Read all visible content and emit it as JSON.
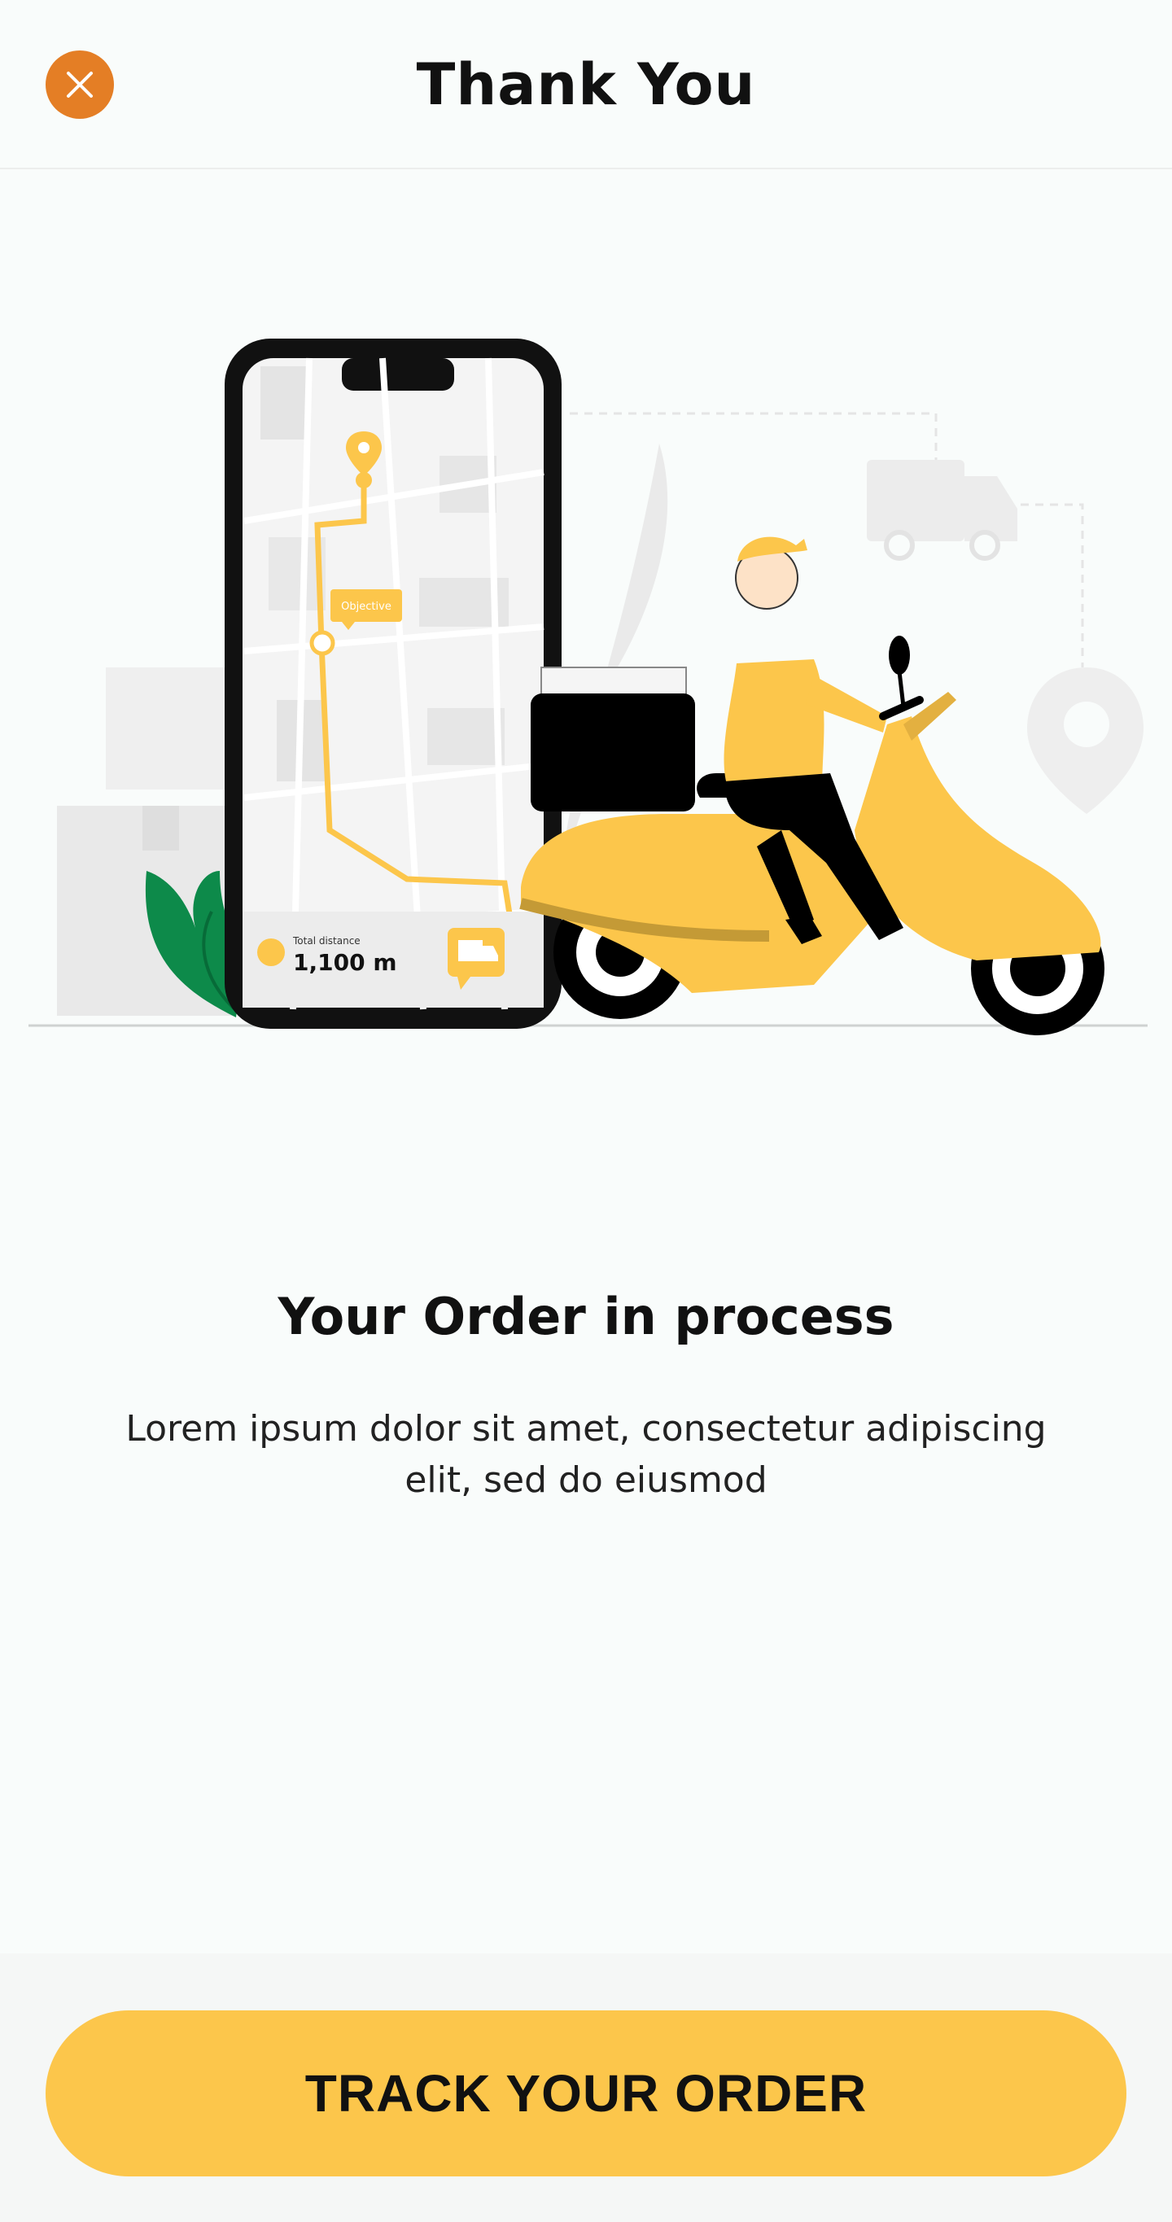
{
  "header": {
    "title": "Thank You",
    "close_icon": "close-icon"
  },
  "illustration": {
    "description_icon": "delivery-scooter-illustration",
    "map_callout": "Objective",
    "distance_label": "Total distance",
    "distance_value": "1,100 m",
    "truck_icon": "truck-icon",
    "pin_icon": "location-pin-icon"
  },
  "main": {
    "heading": "Your Order in process",
    "description": "Lorem ipsum dolor sit amet, consectetur adipiscing elit, sed do eiusmod"
  },
  "footer": {
    "track_label": "TRACK YOUR ORDER"
  },
  "colors": {
    "accent_orange": "#e47e25",
    "accent_yellow": "#fcc64b",
    "background": "#f9fcfb"
  }
}
